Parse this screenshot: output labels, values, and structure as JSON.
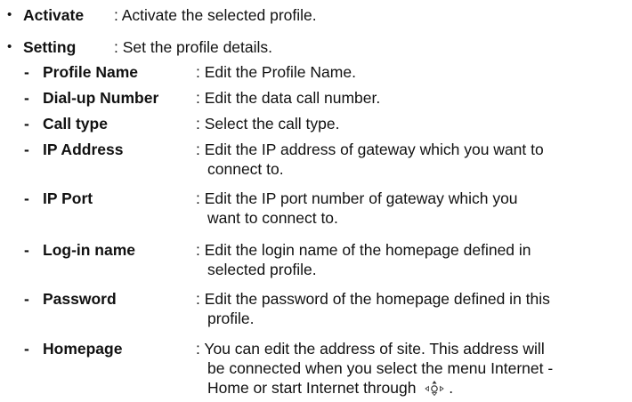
{
  "items": [
    {
      "term": "Activate",
      "desc": ": Activate the selected profile."
    },
    {
      "term": "Setting",
      "desc": ": Set the profile details."
    }
  ],
  "sub_items": [
    {
      "term": "Profile Name",
      "line1": ": Edit the Profile Name.",
      "line2": ""
    },
    {
      "term": "Dial-up Number",
      "line1": ": Edit the data call number.",
      "line2": ""
    },
    {
      "term": "Call type",
      "line1": ": Select the call type.",
      "line2": ""
    },
    {
      "term": "IP Address",
      "line1": ": Edit the IP address of gateway which you want to",
      "line2": "connect to."
    },
    {
      "term": "IP Port",
      "line1": ": Edit the IP port number of gateway which you",
      "line2": "want to connect to."
    },
    {
      "term": "Log-in name",
      "line1": ": Edit the login name of the homepage defined in",
      "line2": "selected profile."
    },
    {
      "term": "Password",
      "line1": ": Edit the password of the homepage defined in this",
      "line2": "profile."
    },
    {
      "term": "Homepage",
      "line1": ": You can edit the address of site. This address will",
      "line2": "be connected when you select the menu Internet -",
      "line3_pre": "Home or start Internet through",
      "line3_post": "."
    }
  ],
  "symbols": {
    "bullet": "•",
    "dash": "-",
    "joystick_icon": "joystick-up-icon"
  }
}
